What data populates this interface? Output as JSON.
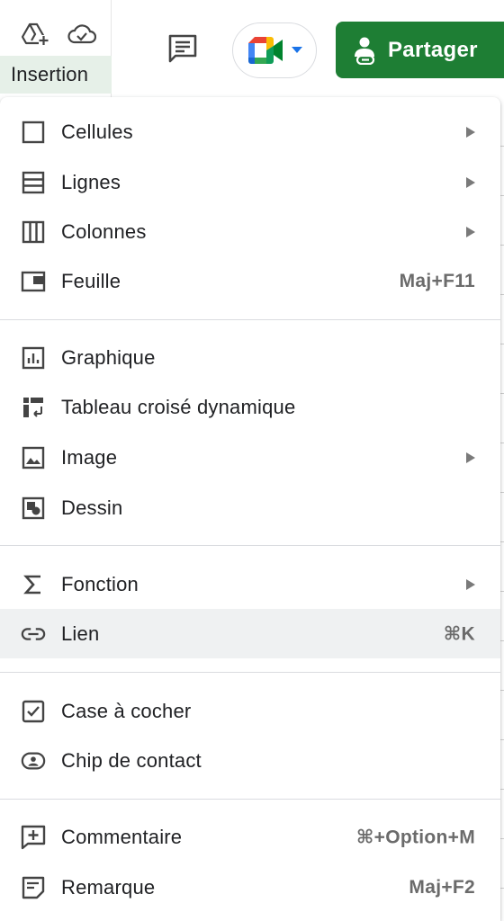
{
  "toolbar": {
    "active_menu": "Insertion",
    "share_label": "Partager",
    "icons": [
      "drive-add-icon",
      "cloud-status-icon",
      "comment-icon",
      "meet-icon",
      "share-person-icon"
    ],
    "colors": {
      "share_bg": "#1e7e34",
      "active_tab_bg": "#e6f0e8"
    }
  },
  "menu": {
    "items": [
      {
        "label": "Cellules",
        "icon": "cell-icon",
        "submenu": true,
        "shortcut": ""
      },
      {
        "label": "Lignes",
        "icon": "rows-icon",
        "submenu": true,
        "shortcut": ""
      },
      {
        "label": "Colonnes",
        "icon": "columns-icon",
        "submenu": true,
        "shortcut": ""
      },
      {
        "label": "Feuille",
        "icon": "sheet-icon",
        "submenu": false,
        "shortcut": "Maj+F11"
      },
      {
        "label": "Graphique",
        "icon": "chart-icon",
        "submenu": false,
        "shortcut": ""
      },
      {
        "label": "Tableau croisé dynamique",
        "icon": "pivot-table-icon",
        "submenu": false,
        "shortcut": ""
      },
      {
        "label": "Image",
        "icon": "image-icon",
        "submenu": true,
        "shortcut": ""
      },
      {
        "label": "Dessin",
        "icon": "drawing-icon",
        "submenu": false,
        "shortcut": ""
      },
      {
        "label": "Fonction",
        "icon": "sigma-icon",
        "submenu": true,
        "shortcut": ""
      },
      {
        "label": "Lien",
        "icon": "link-icon",
        "submenu": false,
        "shortcut": "⌘K",
        "highlighted": true
      },
      {
        "label": "Case à cocher",
        "icon": "checkbox-icon",
        "submenu": false,
        "shortcut": ""
      },
      {
        "label": "Chip de contact",
        "icon": "contact-chip-icon",
        "submenu": false,
        "shortcut": ""
      },
      {
        "label": "Commentaire",
        "icon": "add-comment-icon",
        "submenu": false,
        "shortcut": "⌘+Option+M"
      },
      {
        "label": "Remarque",
        "icon": "note-icon",
        "submenu": false,
        "shortcut": "Maj+F2"
      }
    ]
  }
}
